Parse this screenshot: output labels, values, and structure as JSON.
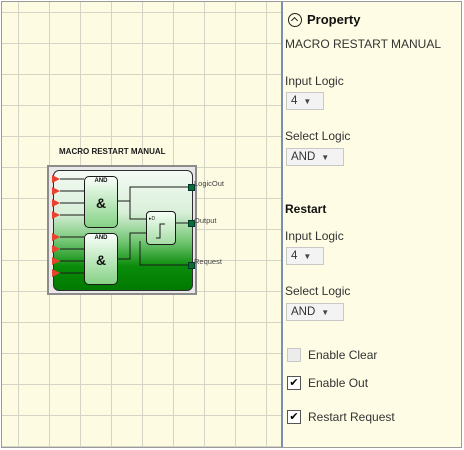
{
  "block": {
    "title": "MACRO RESTART MANUAL",
    "gate_top_label": "AND",
    "gate_bottom_label": "AND",
    "gate_symbol": "&",
    "outputs": [
      "LogicOut",
      "Output",
      "Request"
    ]
  },
  "property": {
    "header": "Property",
    "macro_name": "MACRO RESTART MANUAL",
    "input_logic_label": "Input Logic",
    "input_logic_value": "4",
    "select_logic_label": "Select Logic",
    "select_logic_value": "AND",
    "restart_header": "Restart",
    "restart_input_logic_label": "Input Logic",
    "restart_input_logic_value": "4",
    "restart_select_logic_label": "Select Logic",
    "restart_select_logic_value": "AND",
    "enable_clear_label": "Enable Clear",
    "enable_clear_checked": false,
    "enable_out_label": "Enable Out",
    "enable_out_checked": true,
    "restart_request_label": "Restart Request",
    "restart_request_checked": true
  },
  "icons": {
    "collapse": "chevron-up-circle-icon",
    "input_port": "triangle-input-port-icon",
    "output_port": "square-output-port-icon"
  },
  "colors": {
    "canvas_bg": "#fdfbe2",
    "panel_bg": "#fefce4",
    "input_port": "#e8412e",
    "output_port": "#0a6f2a",
    "block_green": "#0a8c0a"
  }
}
